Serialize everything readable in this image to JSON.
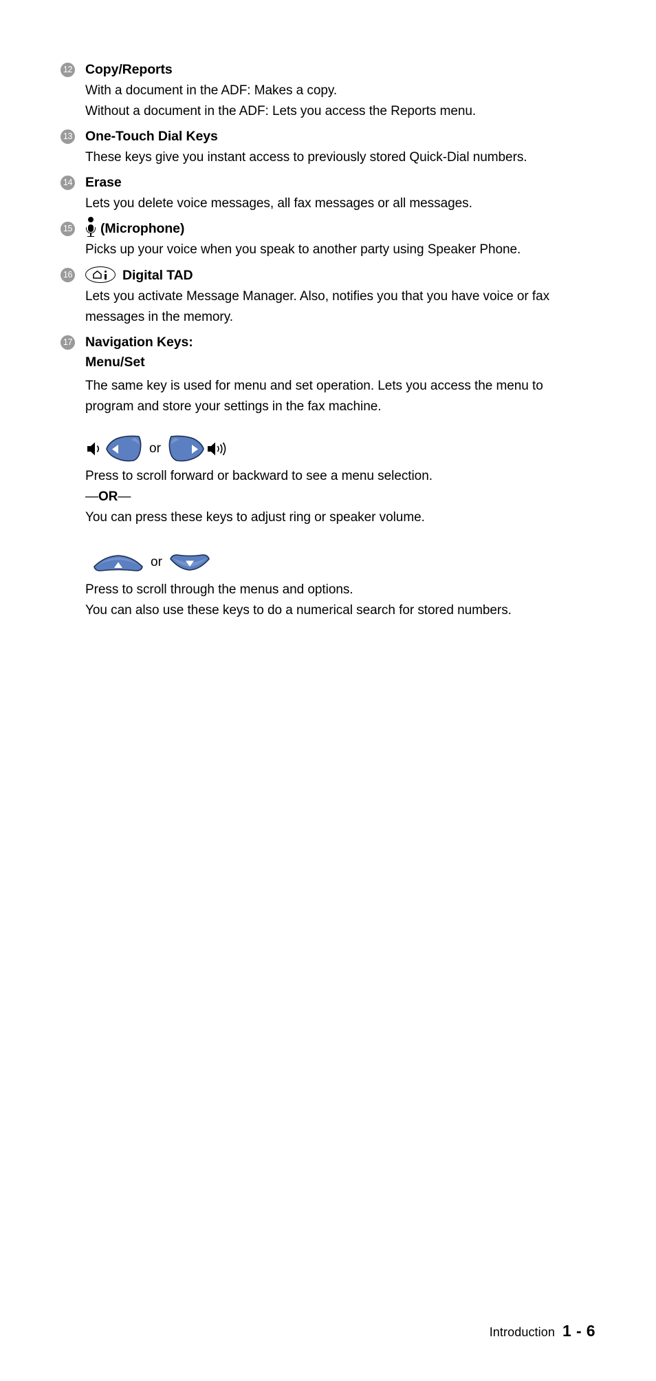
{
  "document": {
    "type": "user-manual-page",
    "sections": [
      {
        "number": "12",
        "title": "Copy/Reports",
        "icon": null,
        "paragraphs": [
          "With a document in the ADF: Makes a copy.",
          "Without a document in the ADF: Lets you access the Reports menu."
        ]
      },
      {
        "number": "13",
        "title": "One-Touch Dial Keys",
        "icon": null,
        "paragraphs": [
          "These keys give you instant access to previously stored Quick-Dial numbers."
        ]
      },
      {
        "number": "14",
        "title": "Erase",
        "icon": null,
        "paragraphs": [
          "Lets you delete voice messages, all fax messages or all messages."
        ]
      },
      {
        "number": "15",
        "title": "(Microphone)",
        "icon": "microphone-icon",
        "paragraphs": [
          "Picks up your voice when you speak to another party using Speaker Phone."
        ]
      },
      {
        "number": "16",
        "title": "Digital TAD",
        "icon": "digital-tad-icon",
        "paragraphs": [
          "Lets you activate Message Manager. Also, notifies you that you have voice or fax messages in the memory."
        ]
      },
      {
        "number": "17",
        "title": "Navigation Keys:",
        "icon": null,
        "subheading": "Menu/Set",
        "paragraphs": [
          "The same key is used for menu and set operation. Lets you access the menu to program and store your settings in the fax machine."
        ],
        "key_groups": [
          {
            "name": "volume-keys",
            "or_label": "or",
            "left_icon": "speaker-low-icon",
            "left_key": "left-arrow-key",
            "right_key": "right-arrow-key",
            "right_icon": "speaker-high-icon",
            "lines": [
              "Press to scroll forward or backward to see a menu selection.",
              "—OR—",
              "You can press these keys to adjust ring or speaker volume."
            ],
            "or_text_bold": "OR",
            "or_text_prefix": "—",
            "or_text_suffix": "—"
          },
          {
            "name": "scroll-keys",
            "or_label": "or",
            "left_key": "up-arrow-key",
            "right_key": "down-arrow-key",
            "lines": [
              "Press to scroll through the menus and options.",
              "You can also use these keys to do a numerical search for stored numbers."
            ]
          }
        ]
      }
    ]
  },
  "footer": {
    "chapter": "Introduction",
    "page": "1 - 6"
  },
  "colors": {
    "badge_background": "#9a9a9a",
    "badge_text": "#ffffff",
    "key_blue": "#5b7fc0",
    "key_blue_dark": "#3f5f9e",
    "text": "#000000",
    "background": "#ffffff"
  }
}
